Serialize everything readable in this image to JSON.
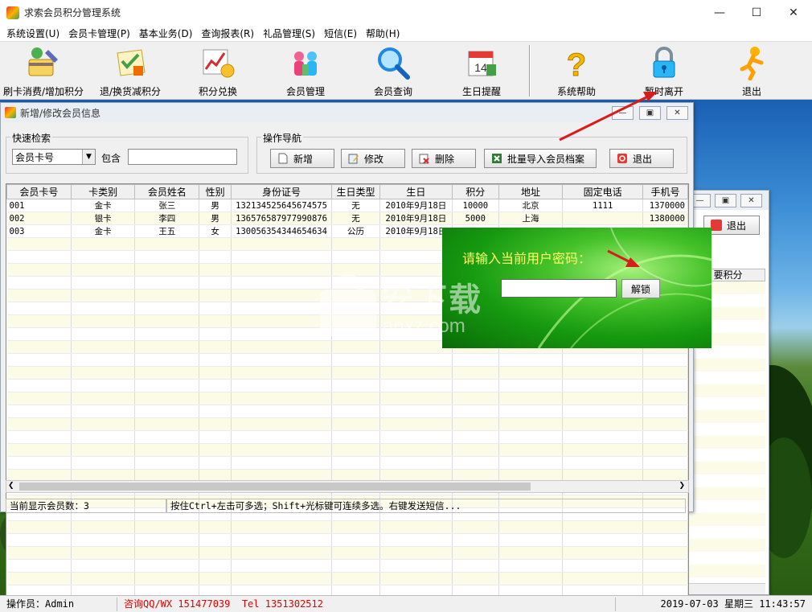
{
  "window": {
    "title": "求索会员积分管理系统"
  },
  "menu": [
    "系统设置(U)",
    "会员卡管理(P)",
    "基本业务(D)",
    "查询报表(R)",
    "礼品管理(S)",
    "短信(E)",
    "帮助(H)"
  ],
  "toolbar": [
    {
      "label": "刷卡消费/增加积分",
      "icon": "card-pen-icon"
    },
    {
      "label": "退/换货减积分",
      "icon": "return-check-icon"
    },
    {
      "label": "积分兑换",
      "icon": "chart-coins-icon"
    },
    {
      "label": "会员管理",
      "icon": "members-icon"
    },
    {
      "label": "会员查询",
      "icon": "magnifier-icon"
    },
    {
      "label": "生日提醒",
      "icon": "calendar-icon"
    },
    {
      "label": "系统帮助",
      "icon": "question-icon"
    },
    {
      "label": "暂时离开",
      "icon": "lock-icon"
    },
    {
      "label": "退出",
      "icon": "runner-icon"
    }
  ],
  "member_window": {
    "title": "新增/修改会员信息",
    "quick_search": {
      "group_label": "快速检索",
      "field_value": "会员卡号",
      "contains_label": "包含",
      "query": ""
    },
    "nav": {
      "group_label": "操作导航",
      "add": "新增",
      "edit": "修改",
      "delete": "删除",
      "import": "批量导入会员档案",
      "exit": "退出"
    },
    "columns": [
      "会员卡号",
      "卡类别",
      "会员姓名",
      "性别",
      "身份证号",
      "生日类型",
      "生日",
      "积分",
      "地址",
      "固定电话",
      "手机号"
    ],
    "rows": [
      [
        "001",
        "金卡",
        "张三",
        "男",
        "132134525645674575",
        "无",
        "2010年9月18日",
        "10000",
        "北京",
        "1111",
        "1370000"
      ],
      [
        "002",
        "银卡",
        "李四",
        "男",
        "136576587977990876",
        "无",
        "2010年9月18日",
        "5000",
        "上海",
        "",
        "1380000"
      ],
      [
        "003",
        "金卡",
        "王五",
        "女",
        "130056354344654634",
        "公历",
        "2010年9月18日",
        "",
        "",
        "",
        ""
      ]
    ],
    "status_count": "当前显示会员数：3",
    "status_hint": "按住Ctrl+左击可多选；Shift+光标键可连续多选。右键发送短信..."
  },
  "back_window": {
    "exit_label": "退出",
    "column_label": "要积分"
  },
  "password_dialog": {
    "prompt": "请输入当前用户密码：",
    "value": "",
    "unlock_label": "解锁"
  },
  "watermark": {
    "text_cn": "安下载",
    "text_en": "anxz.com"
  },
  "statusbar": {
    "operator": "操作员：Admin",
    "contact_qq": "咨询QQ/WX 151477039",
    "contact_tel": "Tel 1351302512",
    "datetime": "2019-07-03 星期三 11:43:57"
  },
  "colors": {
    "contact": "#e00000",
    "annotation_arrow": "#d81b1b",
    "prompt_text": "#ffff66"
  }
}
